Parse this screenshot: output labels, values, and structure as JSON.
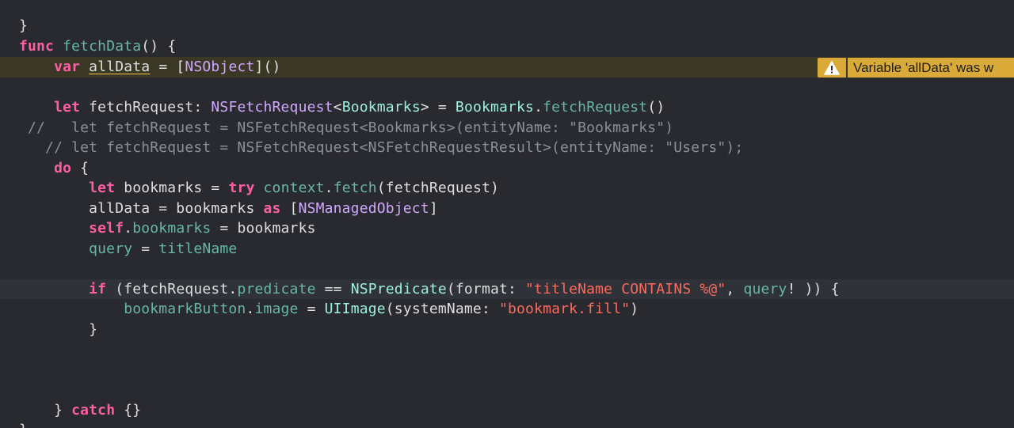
{
  "colors": {
    "background": "#292a30",
    "keyword": "#fc5fa3",
    "function": "#67b7a4",
    "type": "#d0a8ff",
    "type_alt": "#9ef1dd",
    "string": "#fc6a5d",
    "comment": "#8b8f96",
    "plain": "#dfdfe0",
    "warning": "#d9aa38"
  },
  "warning": {
    "icon": "warning-triangle-icon",
    "text": "Variable 'allData' was w"
  },
  "code": {
    "l1": {
      "close": "}"
    },
    "l2": {
      "kw": "func",
      "name": "fetchData",
      "rest": "() {"
    },
    "l3": {
      "indent": "    ",
      "kw": "var",
      "a": " ",
      "var": "allData",
      "b": " = [",
      "type": "NSObject",
      "c": "]()"
    },
    "l5": {
      "indent": "    ",
      "kw": "let",
      "a": " fetchRequest: ",
      "type": "NSFetchRequest",
      "b": "<",
      "type2": "Bookmarks",
      "c": "> = ",
      "type3": "Bookmarks",
      "d": ".",
      "fn": "fetchRequest",
      "e": "()"
    },
    "l6": {
      "text": " //   let fetchRequest = NSFetchRequest<Bookmarks>(entityName: \"Bookmarks\")"
    },
    "l7": {
      "text": "   // let fetchRequest = NSFetchRequest<NSFetchRequestResult>(entityName: \"Users\");"
    },
    "l8": {
      "indent": "    ",
      "kw": "do",
      "rest": " {"
    },
    "l9": {
      "indent": "        ",
      "kw": "let",
      "a": " bookmarks = ",
      "kw2": "try",
      "b": " ",
      "fn": "context",
      "c": ".",
      "fn2": "fetch",
      "d": "(fetchRequest)"
    },
    "l10": {
      "indent": "        ",
      "a": "allData = bookmarks ",
      "kw": "as",
      "b": " [",
      "type": "NSManagedObject",
      "c": "]"
    },
    "l11": {
      "indent": "        ",
      "kw": "self",
      "a": ".",
      "fn": "bookmarks",
      "b": " = bookmarks"
    },
    "l12": {
      "indent": "        ",
      "fn": "query",
      "a": " = ",
      "fn2": "titleName"
    },
    "l14": {
      "indent": "        ",
      "kw": "if",
      "a": " (fetchRequest.",
      "fn": "predicate",
      "b": " == ",
      "type": "NSPredicate",
      "c": "(format: ",
      "str": "\"titleName CONTAINS %@\"",
      "d": ", ",
      "fn2": "query",
      "e": "! )) {"
    },
    "l15": {
      "indent": "            ",
      "fn": "bookmarkButton",
      "a": ".",
      "fn2": "image",
      "b": " = ",
      "type": "UIImage",
      "c": "(systemName: ",
      "str": "\"bookmark.fill\"",
      "d": ")"
    },
    "l16": {
      "indent": "        ",
      "close": "}"
    },
    "l20": {
      "indent": "    ",
      "a": "} ",
      "kw": "catch",
      "b": " {}"
    },
    "l21": {
      "close": "}"
    }
  }
}
